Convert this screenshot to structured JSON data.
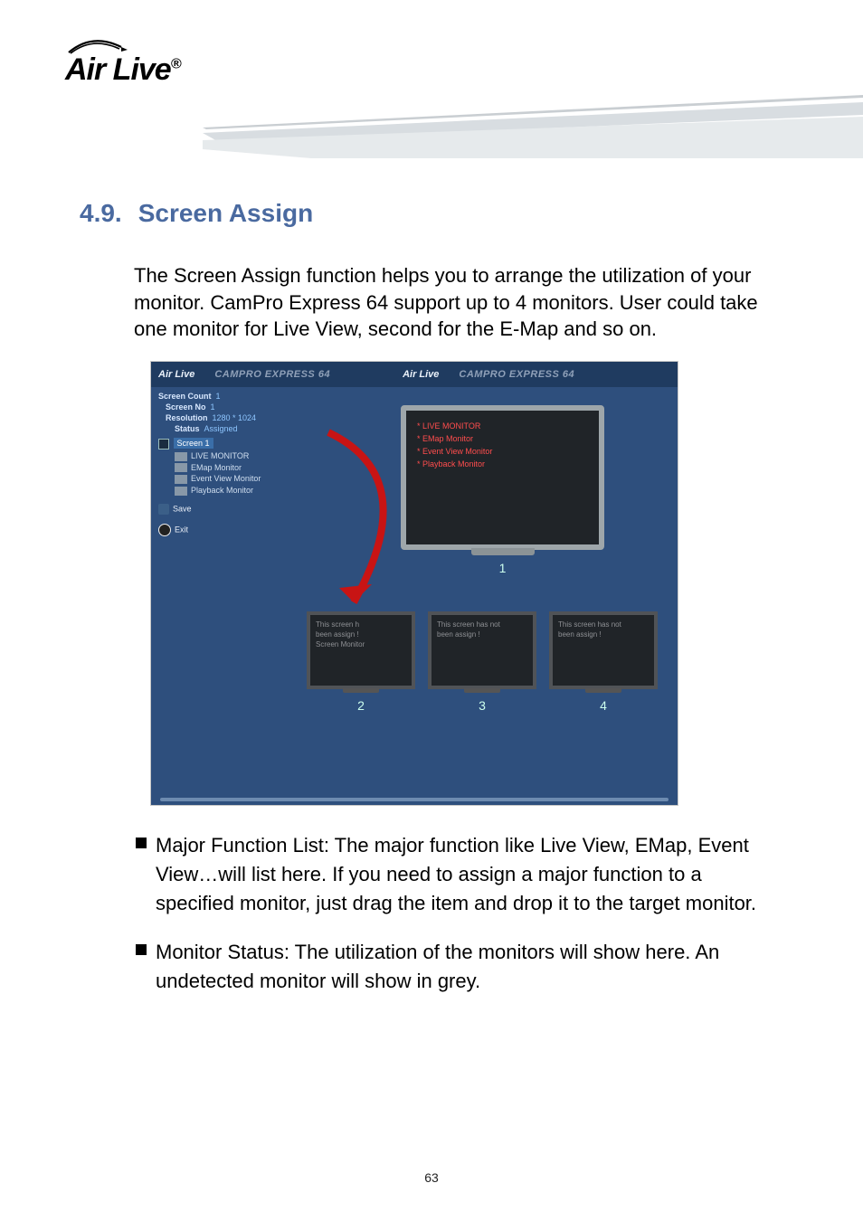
{
  "logo": {
    "text": "Air Live",
    "registered": "®"
  },
  "section": {
    "number": "4.9.",
    "title": "Screen Assign"
  },
  "intro": "The Screen Assign function helps you to arrange the utilization of your monitor. CamPro Express 64 support up to 4 monitors. User could take one monitor for Live View, second for the E-Map and so on.",
  "screenshot": {
    "brand": "Air Live",
    "product": "CAMPRO EXPRESS 64",
    "sidebar": {
      "screen_count_label": "Screen Count",
      "screen_count_value": "1",
      "screen_no_label": "Screen No",
      "screen_no_value": "1",
      "resolution_label": "Resolution",
      "resolution_value": "1280 * 1024",
      "status_label": "Status",
      "status_value": "Assigned",
      "tree_root": "Screen 1",
      "items": [
        {
          "label": "LIVE MONITOR"
        },
        {
          "label": "EMap Monitor"
        },
        {
          "label": "Event View Monitor"
        },
        {
          "label": "Playback Monitor"
        }
      ],
      "save": "Save",
      "exit": "Exit"
    },
    "monitor1": {
      "lines": [
        "* LIVE MONITOR",
        "* EMap Monitor",
        "* Event View Monitor",
        "* Playback Monitor"
      ],
      "label": "1"
    },
    "thumbs": [
      {
        "line1": "This screen h",
        "line2": "been assign !",
        "line3": "Screen Monitor",
        "label": "2"
      },
      {
        "line1": "This screen has not",
        "line2": "been assign !",
        "line3": "",
        "label": "3"
      },
      {
        "line1": "This screen has not",
        "line2": "been assign !",
        "line3": "",
        "label": "4"
      }
    ]
  },
  "bullets": [
    "Major Function List: The major function like Live View, EMap, Event View…will list here. If you need to assign a major function to a specified monitor, just drag the item and drop it to the target monitor.",
    "Monitor Status: The utilization of the monitors will show here. An undetected monitor will show in grey."
  ],
  "page_number": "63"
}
